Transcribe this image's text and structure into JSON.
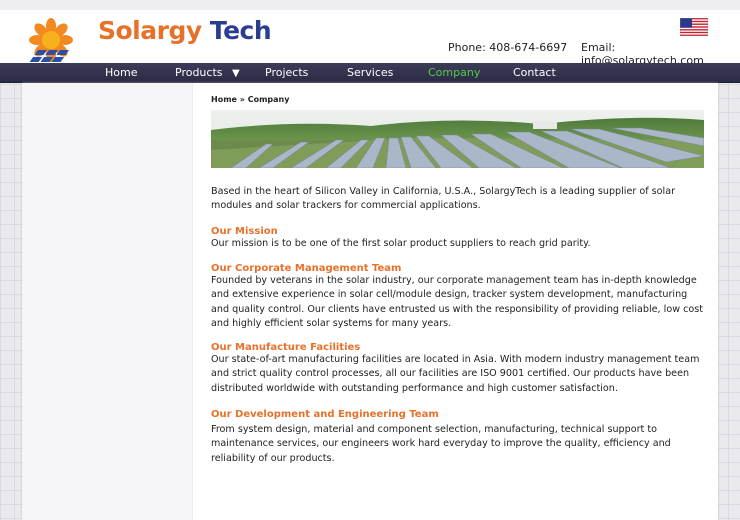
{
  "brand": {
    "name_part1": "Solargy",
    "name_part2": " Tech",
    "orange": "#e8712a",
    "navy": "#2b3d8f"
  },
  "header": {
    "phone": "Phone: 408-674-6697",
    "email": "Email: info@solargytech.com",
    "flag_icon": "us-flag-icon"
  },
  "nav": {
    "items": [
      {
        "label": "Home"
      },
      {
        "label": "Products"
      },
      {
        "label": "Projects"
      },
      {
        "label": "Services"
      },
      {
        "label": "Company",
        "active": true
      },
      {
        "label": "Contact"
      }
    ],
    "dropdown_icon": "▼",
    "active_color": "#55cc44"
  },
  "breadcrumb": {
    "home": "Home",
    "separator": " » ",
    "current": "Company"
  },
  "content": {
    "intro": "Based in the heart of Silicon Valley in California, U.S.A., SolargyTech is a leading supplier of solar modules and solar trackers for commercial applications.",
    "sections": [
      {
        "heading": "Our Mission",
        "body": "Our mission is to be one of the first solar product suppliers to reach grid parity."
      },
      {
        "heading": "Our Corporate Management Team",
        "body": "Founded by veterans in the solar industry, our corporate management team has in-depth knowledge and extensive experience in solar cell/module design, tracker system development, manufacturing and quality control. Our clients have entrusted us with the responsibility of providing reliable, low cost and highly efficient solar systems for many years."
      },
      {
        "heading": "Our Manufacture Facilities",
        "body": "Our state-of-art manufacturing facilities are located in Asia. With modern industry management team and strict quality control processes, all our facilities are ISO 9001 certified. Our products have been distributed worldwide with outstanding performance and high customer satisfaction."
      },
      {
        "heading": "Our Development and Engineering Team",
        "body": "From system design, material and component selection, manufacturing, technical support to maintenance services, our engineers work hard everyday to improve the quality, efficiency and reliability of our products."
      }
    ]
  }
}
